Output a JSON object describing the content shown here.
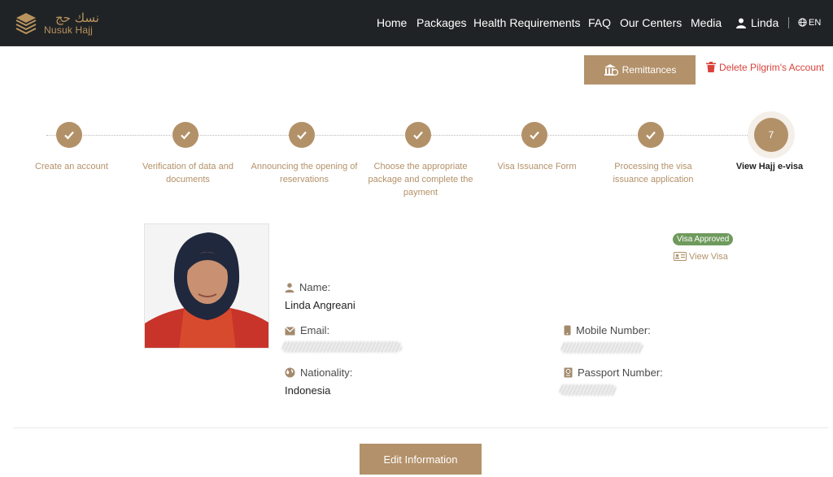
{
  "header": {
    "logo": {
      "arabic": "نسك حج",
      "english": "Nusuk Hajj"
    },
    "nav": [
      {
        "label": "Home",
        "icon": ""
      },
      {
        "label": "Packages",
        "icon": ""
      },
      {
        "label": "Health Requirements",
        "icon": ""
      },
      {
        "label": "FAQ",
        "icon": ""
      },
      {
        "label": "Our Centers",
        "icon": ""
      },
      {
        "label": "Media",
        "icon": ""
      }
    ],
    "user_name": "Linda",
    "language": "EN"
  },
  "actions": {
    "remittances_label": "Remittances",
    "delete_label": "Delete Pilgrim's Account"
  },
  "stepper": {
    "steps": [
      {
        "label": "Create an account",
        "state": "done"
      },
      {
        "label": "Verification of data and documents",
        "state": "done"
      },
      {
        "label": "Announcing the opening of reservations",
        "state": "done"
      },
      {
        "label": "Choose the appropriate package and complete the payment",
        "state": "done"
      },
      {
        "label": "Visa Issuance Form",
        "state": "done"
      },
      {
        "label": "Processing the visa issuance application",
        "state": "done"
      },
      {
        "label": "View Hajj e-visa",
        "state": "current",
        "number": "7"
      }
    ]
  },
  "profile": {
    "visa_status": "Visa Approved",
    "view_visa_label": "View Visa",
    "name_label": "Name:",
    "name_value": "Linda Angreani",
    "email_label": "Email:",
    "mobile_label": "Mobile Number:",
    "nationality_label": "Nationality:",
    "nationality_value": "Indonesia",
    "passport_label": "Passport Number:"
  },
  "edit_label": "Edit Information",
  "colors": {
    "accent": "#b39168",
    "header_bg": "#202325",
    "danger": "#d9423a",
    "approved": "#6f9a5d"
  }
}
